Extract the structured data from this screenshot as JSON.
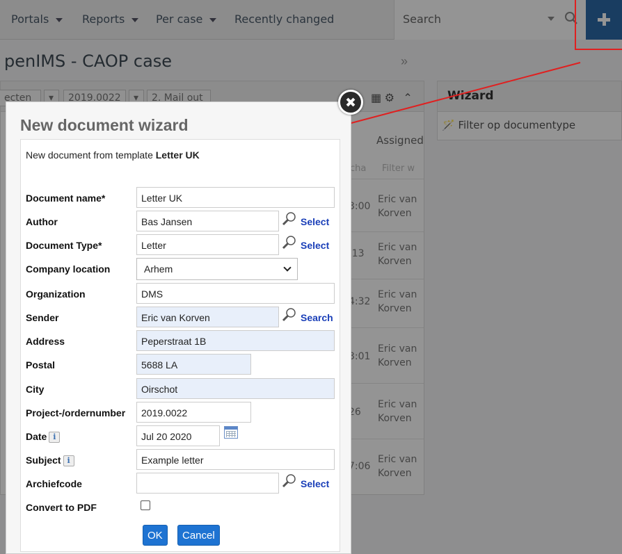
{
  "nav": {
    "items": [
      {
        "label": "Portals",
        "has_menu": true
      },
      {
        "label": "Reports",
        "has_menu": true
      },
      {
        "label": "Per case",
        "has_menu": true
      },
      {
        "label": "Recently changed",
        "has_menu": false
      }
    ],
    "search_placeholder": "Search"
  },
  "page": {
    "title": "penIMS - CAOP case",
    "breadcrumbs": [
      "ecten",
      "2019.0022",
      "2. Mail out"
    ]
  },
  "table": {
    "column_header": "Assigned",
    "filter_placeholders": [
      "cha",
      "Filter w"
    ],
    "rows": [
      {
        "time": "3:00",
        "assignee": "Eric van Korven"
      },
      {
        "time": ":13",
        "assignee": "Eric van Korven"
      },
      {
        "time": "4:32",
        "assignee": "Eric van Korven"
      },
      {
        "time": "3:01",
        "assignee": "Eric van Korven"
      },
      {
        "time": "26",
        "assignee": "Eric van Korven"
      },
      {
        "time": "7:06",
        "assignee": "Eric van Korven"
      }
    ]
  },
  "wizard_panel": {
    "title": "Wizard",
    "filter_label": "Filter op documentype"
  },
  "modal": {
    "title": "New document wizard",
    "intro_prefix": "New document from template ",
    "intro_template": "Letter UK",
    "fields": {
      "document_name": {
        "label": "Document name*",
        "value": "Letter UK"
      },
      "author": {
        "label": "Author",
        "value": "Bas Jansen",
        "action": "Select"
      },
      "document_type": {
        "label": "Document Type*",
        "value": "Letter",
        "action": "Select"
      },
      "company_location": {
        "label": "Company location",
        "value": "Arhem"
      },
      "organization": {
        "label": "Organization",
        "value": "DMS"
      },
      "sender": {
        "label": "Sender",
        "value": "Eric van Korven",
        "action": "Search"
      },
      "address": {
        "label": "Address",
        "value": "Peperstraat 1B"
      },
      "postal": {
        "label": "Postal",
        "value": "5688 LA"
      },
      "city": {
        "label": "City",
        "value": "Oirschot"
      },
      "project": {
        "label": "Project-/ordernumber",
        "value": "2019.0022"
      },
      "date": {
        "label": "Date",
        "value": "Jul 20 2020",
        "info": "i"
      },
      "subject": {
        "label": "Subject",
        "value": "Example letter",
        "info": "i"
      },
      "archiefcode": {
        "label": "Archiefcode",
        "value": "",
        "action": "Select"
      },
      "convert_pdf": {
        "label": "Convert to PDF",
        "checked": false
      }
    },
    "ok_label": "OK",
    "cancel_label": "Cancel"
  },
  "colors": {
    "accent": "#1e73d2",
    "header_button": "#2b6aa8",
    "lookup_link": "#1a3fb8",
    "annotation": "#e02020",
    "highlight_field": "#e8effa"
  }
}
